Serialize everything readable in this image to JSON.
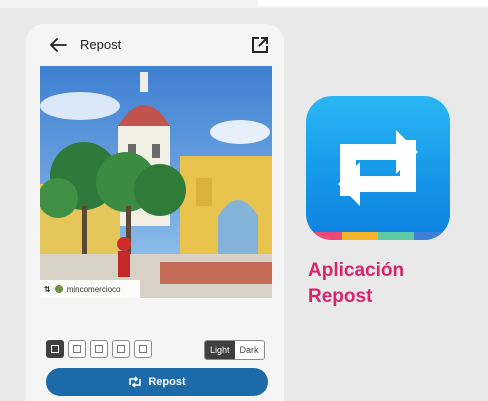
{
  "app_bar": {
    "title": "Repost",
    "back_icon": "arrow-left-icon",
    "open_icon": "open-external-icon"
  },
  "photo": {
    "watermark_username": "mincomercioco",
    "watermark_icon": "repost-mini-icon"
  },
  "layout_options": {
    "selected_index": 0,
    "items": [
      "watermark-bottom-left",
      "watermark-bottom-right",
      "watermark-top-left",
      "watermark-top-right",
      "no-watermark"
    ]
  },
  "theme_toggle": {
    "options": [
      "Light",
      "Dark"
    ],
    "selected": "Light"
  },
  "repost_button": {
    "label": "Repost",
    "icon": "repost-icon",
    "color": "#1d6aa8"
  },
  "promo": {
    "line1": "Aplicación",
    "line2": "Repost",
    "accent_color": "#d6246e",
    "icon_colors": [
      "#2ab7f4",
      "#0d82df"
    ],
    "stripe_colors": [
      "#e94a7a",
      "#f3b52c",
      "#5ec9a5",
      "#3f7fd6"
    ]
  }
}
